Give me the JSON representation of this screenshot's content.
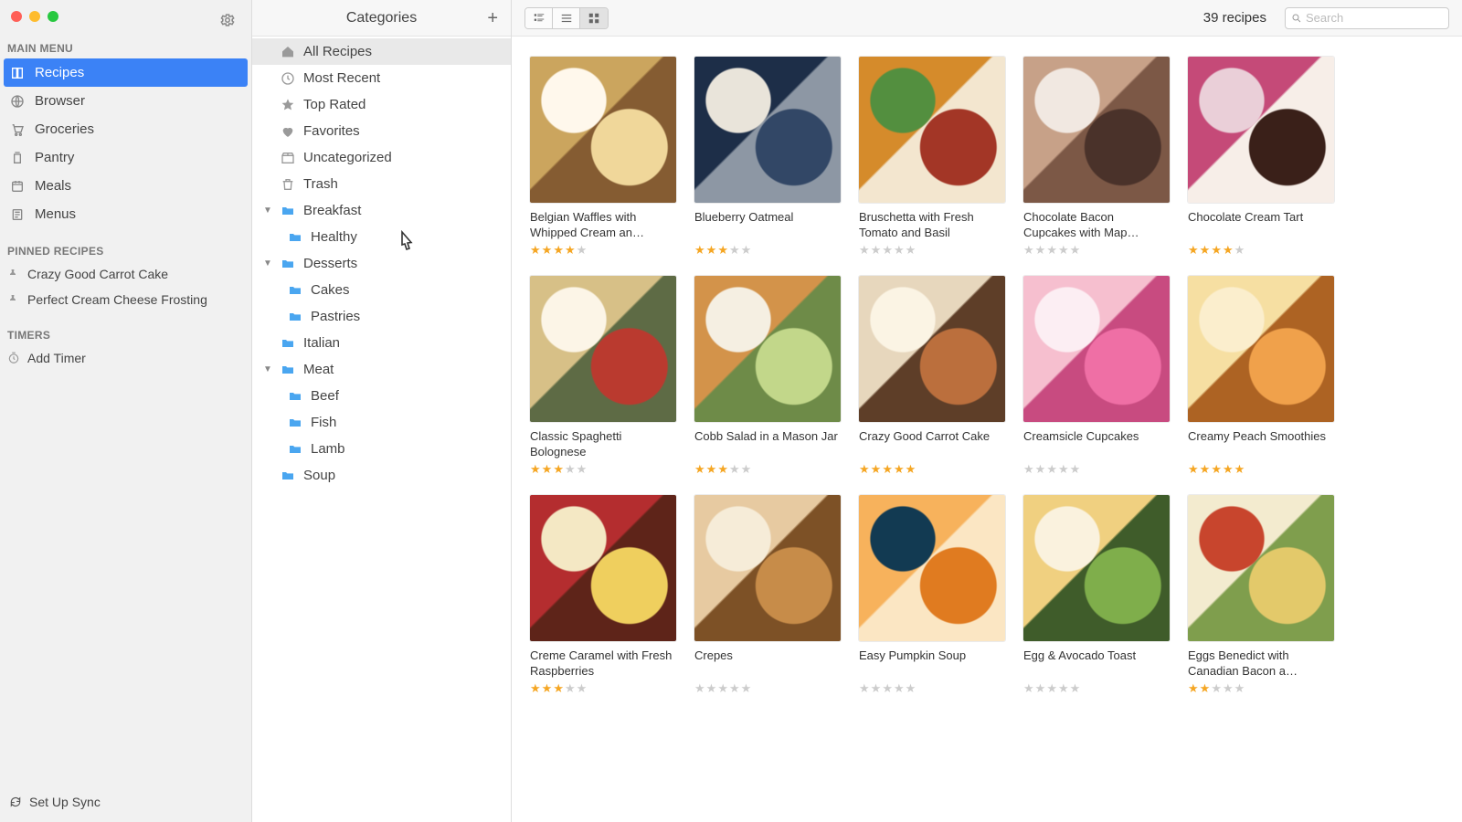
{
  "sidebar": {
    "sections": {
      "main_menu": {
        "label": "MAIN MENU"
      },
      "pinned": {
        "label": "PINNED RECIPES"
      },
      "timers": {
        "label": "TIMERS"
      }
    },
    "items": [
      {
        "id": "recipes",
        "label": "Recipes",
        "icon": "book-icon",
        "selected": true
      },
      {
        "id": "browser",
        "label": "Browser",
        "icon": "globe-icon",
        "selected": false
      },
      {
        "id": "groceries",
        "label": "Groceries",
        "icon": "cart-icon",
        "selected": false
      },
      {
        "id": "pantry",
        "label": "Pantry",
        "icon": "jar-icon",
        "selected": false
      },
      {
        "id": "meals",
        "label": "Meals",
        "icon": "calendar-icon",
        "selected": false
      },
      {
        "id": "menus",
        "label": "Menus",
        "icon": "menu-icon",
        "selected": false
      }
    ],
    "pinned": [
      {
        "label": "Crazy Good Carrot Cake"
      },
      {
        "label": "Perfect Cream Cheese Frosting"
      }
    ],
    "timers": {
      "add_label": "Add Timer"
    },
    "footer": {
      "sync_label": "Set Up Sync"
    }
  },
  "categories": {
    "title": "Categories",
    "items": [
      {
        "label": "All Recipes",
        "icon": "home-icon",
        "depth": 0,
        "selected": true,
        "expandable": false
      },
      {
        "label": "Most Recent",
        "icon": "clock-icon",
        "depth": 0,
        "selected": false,
        "expandable": false
      },
      {
        "label": "Top Rated",
        "icon": "star-icon",
        "depth": 0,
        "selected": false,
        "expandable": false
      },
      {
        "label": "Favorites",
        "icon": "heart-icon",
        "depth": 0,
        "selected": false,
        "expandable": false
      },
      {
        "label": "Uncategorized",
        "icon": "box-icon",
        "depth": 0,
        "selected": false,
        "expandable": false
      },
      {
        "label": "Trash",
        "icon": "trash-icon",
        "depth": 0,
        "selected": false,
        "expandable": false
      },
      {
        "label": "Breakfast",
        "icon": "folder-icon",
        "depth": 0,
        "selected": false,
        "expandable": true,
        "expanded": true
      },
      {
        "label": "Healthy",
        "icon": "folder-icon",
        "depth": 1,
        "selected": false,
        "expandable": false
      },
      {
        "label": "Desserts",
        "icon": "folder-icon",
        "depth": 0,
        "selected": false,
        "expandable": true,
        "expanded": true
      },
      {
        "label": "Cakes",
        "icon": "folder-icon",
        "depth": 1,
        "selected": false,
        "expandable": false
      },
      {
        "label": "Pastries",
        "icon": "folder-icon",
        "depth": 1,
        "selected": false,
        "expandable": false
      },
      {
        "label": "Italian",
        "icon": "folder-icon",
        "depth": 0,
        "selected": false,
        "expandable": false
      },
      {
        "label": "Meat",
        "icon": "folder-icon",
        "depth": 0,
        "selected": false,
        "expandable": true,
        "expanded": true
      },
      {
        "label": "Beef",
        "icon": "folder-icon",
        "depth": 1,
        "selected": false,
        "expandable": false
      },
      {
        "label": "Fish",
        "icon": "folder-icon",
        "depth": 1,
        "selected": false,
        "expandable": false
      },
      {
        "label": "Lamb",
        "icon": "folder-icon",
        "depth": 1,
        "selected": false,
        "expandable": false
      },
      {
        "label": "Soup",
        "icon": "folder-icon",
        "depth": 0,
        "selected": false,
        "expandable": false
      }
    ]
  },
  "toolbar": {
    "view_mode": "grid",
    "count_label": "39 recipes",
    "search_placeholder": "Search"
  },
  "recipes": [
    {
      "title": "Belgian Waffles with Whipped Cream an…",
      "rating": 4
    },
    {
      "title": "Blueberry Oatmeal",
      "rating": 3
    },
    {
      "title": "Bruschetta with Fresh Tomato and Basil",
      "rating": 0
    },
    {
      "title": "Chocolate Bacon Cupcakes with Map…",
      "rating": 0
    },
    {
      "title": "Chocolate Cream Tart",
      "rating": 4
    },
    {
      "title": "Classic Spaghetti Bolognese",
      "rating": 3
    },
    {
      "title": "Cobb Salad in a Mason Jar",
      "rating": 3
    },
    {
      "title": "Crazy Good Carrot Cake",
      "rating": 5
    },
    {
      "title": "Creamsicle Cupcakes",
      "rating": 0
    },
    {
      "title": "Creamy Peach Smoothies",
      "rating": 5
    },
    {
      "title": "Creme Caramel with Fresh Raspberries",
      "rating": 3
    },
    {
      "title": "Crepes",
      "rating": 0
    },
    {
      "title": "Easy Pumpkin Soup",
      "rating": 0
    },
    {
      "title": "Egg & Avocado Toast",
      "rating": 0
    },
    {
      "title": "Eggs Benedict with Canadian Bacon a…",
      "rating": 2
    }
  ],
  "colors": {
    "accent": "#3b82f6",
    "star_on": "#f5a623",
    "star_off": "#cccccc",
    "folder": "#4aa6f0"
  },
  "thumb_palettes": [
    [
      "#f0d79a",
      "#cba55e",
      "#fff8ec",
      "#855c32"
    ],
    [
      "#324766",
      "#1d2e48",
      "#e9e4da",
      "#8d97a4"
    ],
    [
      "#a33626",
      "#d58b2b",
      "#538f3f",
      "#f3e6cf"
    ],
    [
      "#4a322a",
      "#c7a188",
      "#f1e8e1",
      "#7c5846"
    ],
    [
      "#3a2019",
      "#c54a78",
      "#eacfd8",
      "#f7eee8"
    ],
    [
      "#ba3a2f",
      "#d7c087",
      "#fcf5e7",
      "#5e6b45"
    ],
    [
      "#c2d78a",
      "#d3934a",
      "#f5efe2",
      "#6e8b48"
    ],
    [
      "#bb6f3d",
      "#e7d7bd",
      "#fbf4e4",
      "#5e3e28"
    ],
    [
      "#ef6fa5",
      "#f6bfcf",
      "#fceef3",
      "#c84b80"
    ],
    [
      "#f0a14b",
      "#f6dfa2",
      "#fbeecd",
      "#ad6323"
    ],
    [
      "#efcf5e",
      "#b42d2f",
      "#f4e8c4",
      "#5e2419"
    ],
    [
      "#c78c49",
      "#e7caa1",
      "#f6ecd8",
      "#7d5126"
    ],
    [
      "#e07b20",
      "#f7b25c",
      "#123a52",
      "#fbe6c3"
    ],
    [
      "#7fae4b",
      "#f0d080",
      "#faf2de",
      "#3f5c2a"
    ],
    [
      "#e3c96a",
      "#f3ebcf",
      "#c8452d",
      "#7f9e4d"
    ]
  ]
}
